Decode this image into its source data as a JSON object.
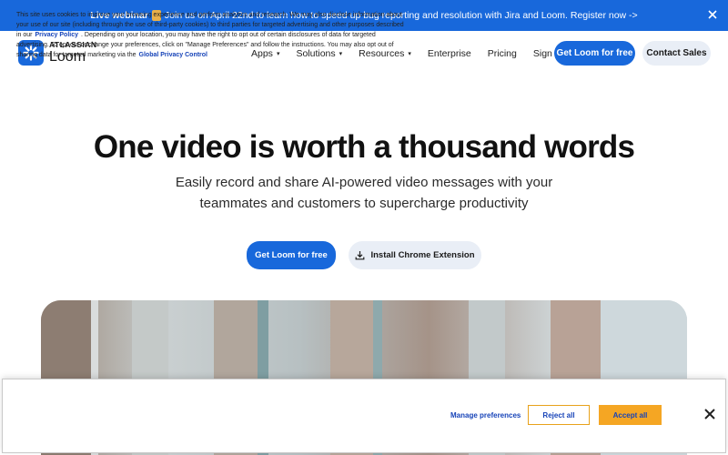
{
  "banner": {
    "lead": "Live webinar",
    "emoji_icon": "hourglass-icon",
    "text": "Join us on April 22nd to learn how to speed up bug reporting and resolution with Jira and Loom. Register now ->"
  },
  "brand": {
    "company": "ATLASSIAN",
    "product": "Loom"
  },
  "nav": {
    "items": [
      {
        "label": "Apps",
        "has_caret": true
      },
      {
        "label": "Solutions",
        "has_caret": true
      },
      {
        "label": "Resources",
        "has_caret": true
      },
      {
        "label": "Enterprise",
        "has_caret": false
      },
      {
        "label": "Pricing",
        "has_caret": false
      },
      {
        "label": "Sign In",
        "has_caret": false
      }
    ],
    "caret": "▾",
    "cta": "Get Loom for free",
    "sales": "Contact Sales"
  },
  "hero": {
    "title": "One video is worth a thousand words",
    "subtitle": "Easily record and share AI-powered video messages with your teammates and customers to supercharge productivity",
    "cta": "Get Loom for free",
    "extension": "Install Chrome Extension"
  },
  "cookie": {
    "text_1": "This site uses cookies to improve your browsing experience and perform analytics and research. We may also disclose information about your use of our site (including through the use of third-party cookies) to third parties for targeted advertising and other purposes described in our",
    "privacy_policy": "Privacy Policy",
    "text_2": ". Depending on your location, you may have the right to opt out of certain disclosures of data for targeted advertising. To opt-out or change your preferences, click on \"Manage Preferences\" and follow the instructions. You may also opt out of sharing data for targeted marketing via the",
    "privacy_control": "Global Privacy Control",
    "manage": "Manage preferences",
    "reject": "Reject all",
    "accept": "Accept all"
  },
  "colors": {
    "brand_blue": "#1868db",
    "accept_orange": "#f5a623",
    "link_blue": "#1643b8"
  }
}
